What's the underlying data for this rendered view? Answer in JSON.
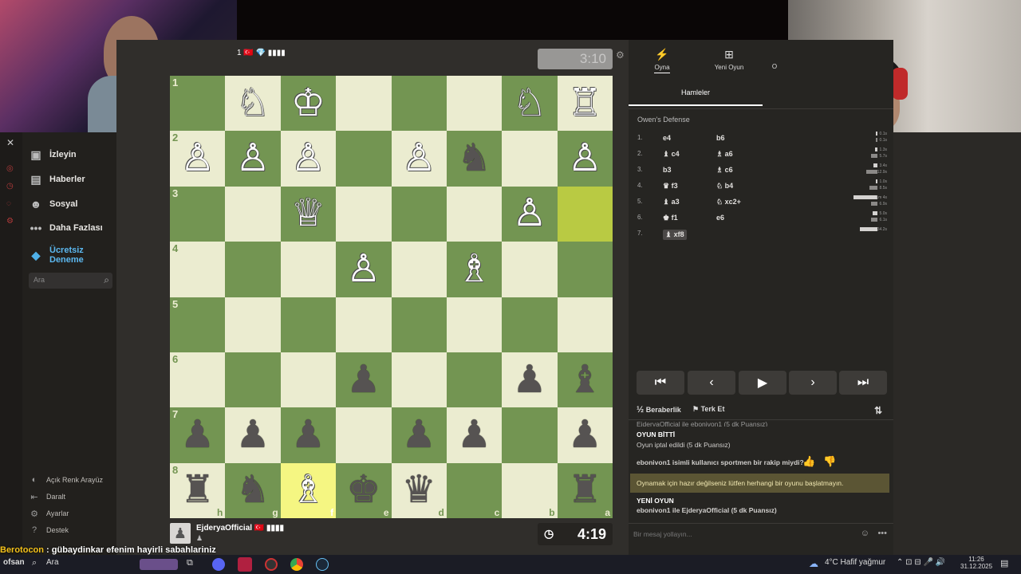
{
  "webcam_left": {
    "label": "streamer webcam"
  },
  "webcam_right": {
    "label": "guest webcam"
  },
  "sidebar": {
    "items": [
      {
        "label": "İzleyin",
        "icon": "tv-icon"
      },
      {
        "label": "Haberler",
        "icon": "news-icon"
      },
      {
        "label": "Sosyal",
        "icon": "people-icon"
      },
      {
        "label": "Daha Fazlası",
        "icon": "more-icon"
      },
      {
        "label": "Ücretsiz Deneme",
        "icon": "diamond-icon"
      }
    ],
    "search_placeholder": "Ara",
    "footer": [
      "Açık Renk Arayüz",
      "Daralt",
      "Ayarlar",
      "Destek"
    ]
  },
  "top_player": {
    "name": "1 🇹🇷 💎 ▮▮▮▮",
    "clock": "3:10"
  },
  "bottom_player": {
    "name": "EjderyaOfficial 🇹🇷 ▮▮▮▮",
    "clock": "4:19"
  },
  "board": {
    "ranks": [
      "1",
      "2",
      "3",
      "4",
      "5",
      "6",
      "7",
      "8"
    ],
    "files": [
      "h",
      "g",
      "f",
      "e",
      "d",
      "c",
      "b",
      "a"
    ],
    "rows": [
      [
        "",
        "♘",
        "♔",
        "",
        "",
        "",
        "♘",
        "♖"
      ],
      [
        "♙",
        "♙",
        "♙",
        "",
        "♙",
        "♞",
        "",
        "♙"
      ],
      [
        "",
        "",
        "♕",
        "",
        "",
        "",
        "♙",
        ""
      ],
      [
        "",
        "",
        "",
        "♙",
        "",
        "♗",
        "",
        ""
      ],
      [
        "",
        "",
        "",
        "",
        "",
        "",
        "",
        ""
      ],
      [
        "",
        "",
        "",
        "♟",
        "",
        "",
        "♟",
        "♝"
      ],
      [
        "♟",
        "♟",
        "♟",
        "",
        "♟",
        "♟",
        "",
        "♟"
      ],
      [
        "♜",
        "♞",
        "♗",
        "♚",
        "♛",
        "",
        "",
        "♜"
      ]
    ]
  },
  "panel": {
    "tabs": [
      "Oyna",
      "Yeni Oyun",
      "O"
    ],
    "subtab": "Hamleler",
    "opening": "Owen's Defense",
    "moves": [
      {
        "num": "1.",
        "white": "e4",
        "black": "b6",
        "t1": "0.1s",
        "t2": "0.1s",
        "w1": 2,
        "w2": 2
      },
      {
        "num": "2.",
        "white": "♝ c4",
        "black": "♗ a6",
        "t1": "1.3s",
        "t2": "5.7s",
        "w1": 3,
        "w2": 8
      },
      {
        "num": "3.",
        "white": "b3",
        "black": "♗ c6",
        "t1": "3.4s",
        "t2": "12.9s",
        "w1": 5,
        "w2": 14
      },
      {
        "num": "4.",
        "white": "♛ f3",
        "black": "♘ b4",
        "t1": "1.0s",
        "t2": "8.5s",
        "w1": 2,
        "w2": 10
      },
      {
        "num": "5.",
        "white": "♝ a3",
        "black": "♘ xc2+",
        "t1": "1m 4s",
        "t2": "6.9s",
        "w1": 30,
        "w2": 8
      },
      {
        "num": "6.",
        "white": "♚ f1",
        "black": "e6",
        "t1": "5.0s",
        "t2": "6.1s",
        "w1": 6,
        "w2": 8
      },
      {
        "num": "7.",
        "white": "♝ xf8",
        "black": "",
        "t1": "34.2s",
        "t2": "",
        "w1": 22,
        "w2": 0
      }
    ],
    "draw": "Beraberlik",
    "resign": "Terk Et",
    "chat": {
      "line0": "EjderyaOfficial ile ebonivon1 (5 dk Puansız)",
      "over_title": "OYUN BİTTİ",
      "over_sub": "Oyun iptal edildi (5 dk Puansız)",
      "question": "ebonivon1 isimli kullanıcı sportmen bir rakip miydi?",
      "warning": "Oynamak için hazır değilseniz lütfen herhangi bir oyunu başlatmayın.",
      "new_title": "YENİ OYUN",
      "new_sub": "ebonivon1 ile EjderyaOfficial (5 dk Puansız)",
      "input_placeholder": "Bir mesaj yollayın..."
    }
  },
  "ticker": {
    "user": "Berotocon",
    "text": " : gübaydinkar efenim hayirli sabahlariniz"
  },
  "taskbar": {
    "search": "Ara",
    "weather": "4°C  Hafif yağmur",
    "time": "11:26",
    "date": "31.12.2025",
    "label": "ofsan"
  }
}
